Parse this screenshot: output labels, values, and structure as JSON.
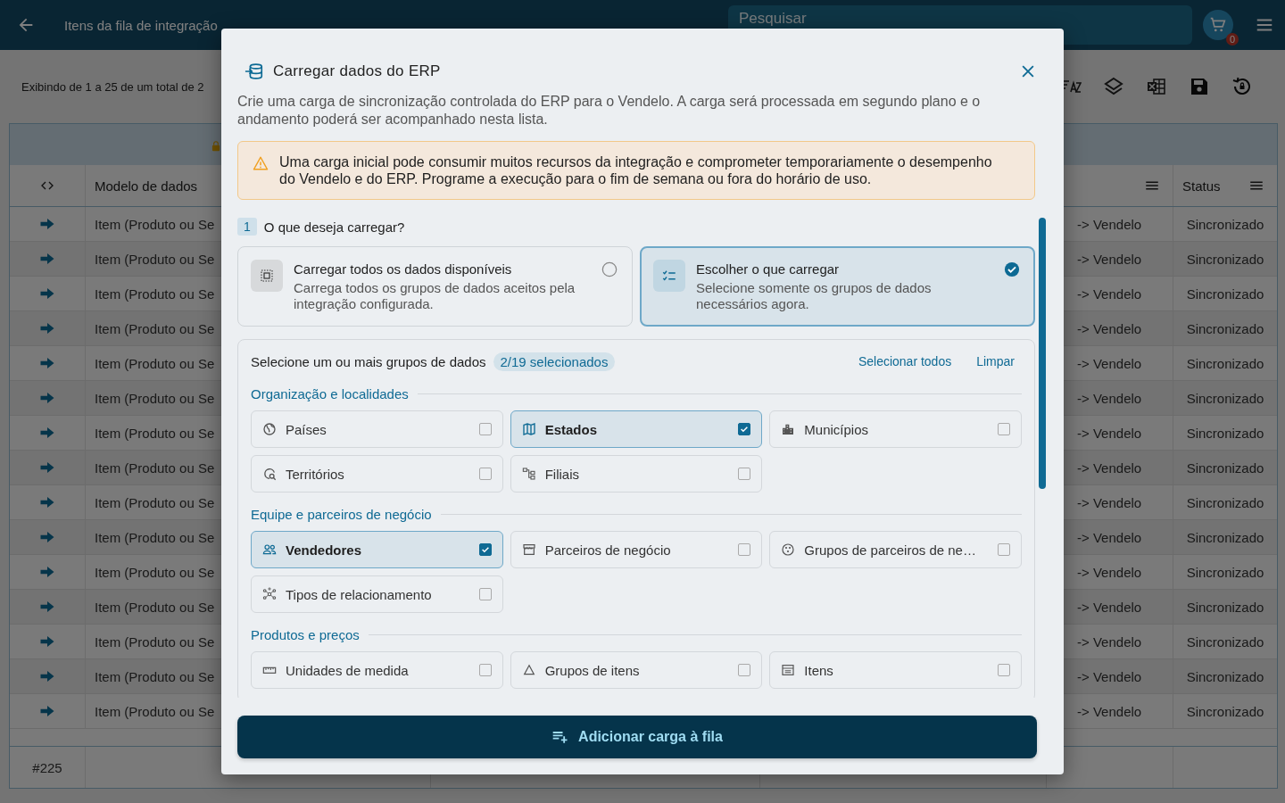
{
  "header": {
    "title": "Itens da fila de integração",
    "search": {
      "placeholder": "Pesquisar"
    },
    "cart_count": "0"
  },
  "toolbar": {
    "summary": "Exibindo de 1 a 25 de um total de 2"
  },
  "table": {
    "columns": [
      {
        "label": "Modelo de dados"
      },
      {
        "label": "Status"
      }
    ],
    "rows": [
      {
        "model": "Item (Produto ou Se",
        "direction": "-> Vendelo",
        "status": "Sincronizado"
      },
      {
        "model": "Item (Produto ou Se",
        "direction": "-> Vendelo",
        "status": "Sincronizado"
      },
      {
        "model": "Item (Produto ou Se",
        "direction": "-> Vendelo",
        "status": "Sincronizado"
      },
      {
        "model": "Item (Produto ou Se",
        "direction": "-> Vendelo",
        "status": "Sincronizado"
      },
      {
        "model": "Item (Produto ou Se",
        "direction": "-> Vendelo",
        "status": "Sincronizado"
      },
      {
        "model": "Item (Produto ou Se",
        "direction": "-> Vendelo",
        "status": "Sincronizado"
      },
      {
        "model": "Item (Produto ou Se",
        "direction": "-> Vendelo",
        "status": "Sincronizado"
      },
      {
        "model": "Item (Produto ou Se",
        "direction": "-> Vendelo",
        "status": "Sincronizado"
      },
      {
        "model": "Item (Produto ou Se",
        "direction": "-> Vendelo",
        "status": "Sincronizado"
      },
      {
        "model": "Item (Produto ou Se",
        "direction": "-> Vendelo",
        "status": "Sincronizado"
      },
      {
        "model": "Item (Produto ou Se",
        "direction": "-> Vendelo",
        "status": "Sincronizado"
      },
      {
        "model": "Item (Produto ou Se",
        "direction": "-> Vendelo",
        "status": "Sincronizado"
      },
      {
        "model": "Item (Produto ou Se",
        "direction": "-> Vendelo",
        "status": "Sincronizado"
      },
      {
        "model": "Item (Produto ou Se",
        "direction": "-> Vendelo",
        "status": "Sincronizado"
      },
      {
        "model": "Item (Produto ou Se",
        "direction": "-> Vendelo",
        "status": "Sincronizado"
      }
    ],
    "footer": "#225"
  },
  "modal": {
    "title": "Carregar dados do ERP",
    "description": "Crie uma carga de sincronização controlada do ERP para o Vendelo. A carga será processada em segundo plano e o andamento poderá ser acompanhado nesta lista.",
    "warning": "Uma carga inicial pode consumir muitos recursos da integração e comprometer temporariamente o desempenho do Vendelo e do ERP. Programe a execução para o fim de semana ou fora do horário de uso.",
    "step": {
      "number": "1",
      "label": "O que deseja carregar?"
    },
    "options": [
      {
        "title": "Carregar todos os dados disponíveis",
        "description": "Carrega todos os grupos de dados aceitos pela integração configurada.",
        "selected": false
      },
      {
        "title": "Escolher o que carregar",
        "description": "Selecione somente os grupos de dados necessários agora.",
        "selected": true
      }
    ],
    "groups_panel": {
      "prompt": "Selecione um ou mais grupos de dados",
      "count": "2/19 selecionados",
      "select_all": "Selecionar todos",
      "clear": "Limpar",
      "groups": [
        {
          "title": "Organização e localidades",
          "items": [
            {
              "label": "Países",
              "checked": false
            },
            {
              "label": "Estados",
              "checked": true
            },
            {
              "label": "Municípios",
              "checked": false
            },
            {
              "label": "Territórios",
              "checked": false
            },
            {
              "label": "Filiais",
              "checked": false
            }
          ]
        },
        {
          "title": "Equipe e parceiros de negócio",
          "items": [
            {
              "label": "Vendedores",
              "checked": true
            },
            {
              "label": "Parceiros de negócio",
              "checked": false
            },
            {
              "label": "Grupos de parceiros de ne…",
              "checked": false
            },
            {
              "label": "Tipos de relacionamento",
              "checked": false
            }
          ]
        },
        {
          "title": "Produtos e preços",
          "items": [
            {
              "label": "Unidades de medida",
              "checked": false
            },
            {
              "label": "Grupos de itens",
              "checked": false
            },
            {
              "label": "Itens",
              "checked": false
            }
          ]
        }
      ]
    },
    "submit": "Adicionar carga à fila"
  }
}
